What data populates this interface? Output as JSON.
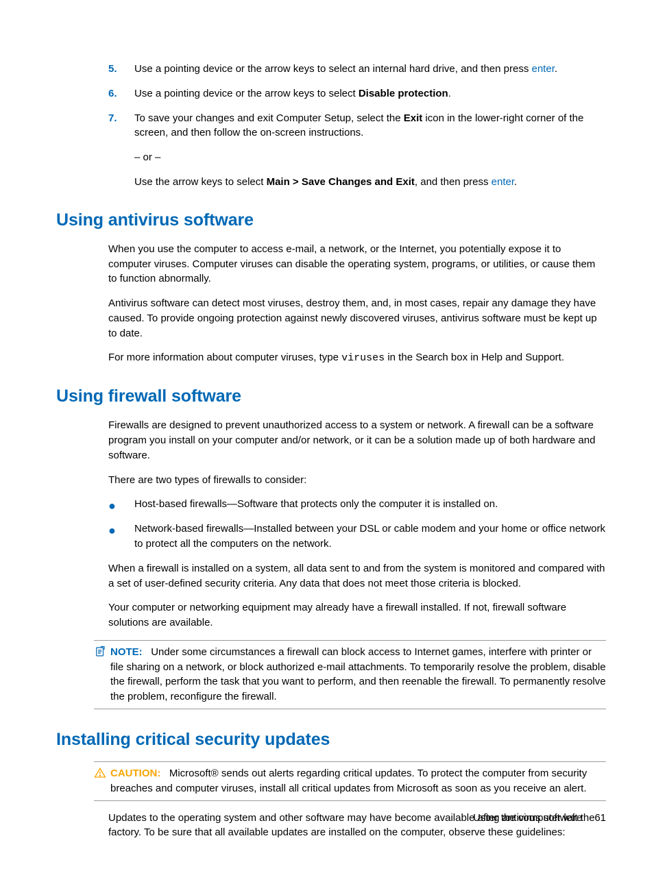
{
  "steps": {
    "s5": {
      "num": "5.",
      "prefix": "Use a pointing device or the arrow keys to select an internal hard drive, and then press ",
      "link": "enter",
      "suffix": "."
    },
    "s6": {
      "num": "6.",
      "prefix": "Use a pointing device or the arrow keys to select ",
      "bold": "Disable protection",
      "suffix": "."
    },
    "s7": {
      "num": "7.",
      "p1a": "To save your changes and exit Computer Setup, select the ",
      "p1b": "Exit",
      "p1c": " icon in the lower-right corner of the screen, and then follow the on-screen instructions.",
      "or": "– or –",
      "p2a": "Use the arrow keys to select ",
      "p2b": "Main > Save Changes and Exit",
      "p2c": ", and then press ",
      "p2link": "enter",
      "p2d": "."
    }
  },
  "antivirus": {
    "heading": "Using antivirus software",
    "p1": "When you use the computer to access e-mail, a network, or the Internet, you potentially expose it to computer viruses. Computer viruses can disable the operating system, programs, or utilities, or cause them to function abnormally.",
    "p2": "Antivirus software can detect most viruses, destroy them, and, in most cases, repair any damage they have caused. To provide ongoing protection against newly discovered viruses, antivirus software must be kept up to date.",
    "p3a": "For more information about computer viruses, type ",
    "p3code": "viruses",
    "p3b": " in the Search box in Help and Support."
  },
  "firewall": {
    "heading": "Using firewall software",
    "p1": "Firewalls are designed to prevent unauthorized access to a system or network. A firewall can be a software program you install on your computer and/or network, or it can be a solution made up of both hardware and software.",
    "p2": "There are two types of firewalls to consider:",
    "b1": "Host-based firewalls—Software that protects only the computer it is installed on.",
    "b2": "Network-based firewalls—Installed between your DSL or cable modem and your home or office network to protect all the computers on the network.",
    "p3": "When a firewall is installed on a system, all data sent to and from the system is monitored and compared with a set of user-defined security criteria. Any data that does not meet those criteria is blocked.",
    "p4": "Your computer or networking equipment may already have a firewall installed. If not, firewall software solutions are available.",
    "note_label": "NOTE:",
    "note_body": "Under some circumstances a firewall can block access to Internet games, interfere with printer or file sharing on a network, or block authorized e-mail attachments. To temporarily resolve the problem, disable the firewall, perform the task that you want to perform, and then reenable the firewall. To permanently resolve the problem, reconfigure the firewall."
  },
  "updates": {
    "heading": "Installing critical security updates",
    "caution_label": "CAUTION:",
    "caution_body": "Microsoft® sends out alerts regarding critical updates. To protect the computer from security breaches and computer viruses, install all critical updates from Microsoft as soon as you receive an alert.",
    "p1": "Updates to the operating system and other software may have become available after the computer left the factory. To be sure that all available updates are installed on the computer, observe these guidelines:"
  },
  "footer": {
    "section": "Using antivirus software",
    "page": "61"
  }
}
